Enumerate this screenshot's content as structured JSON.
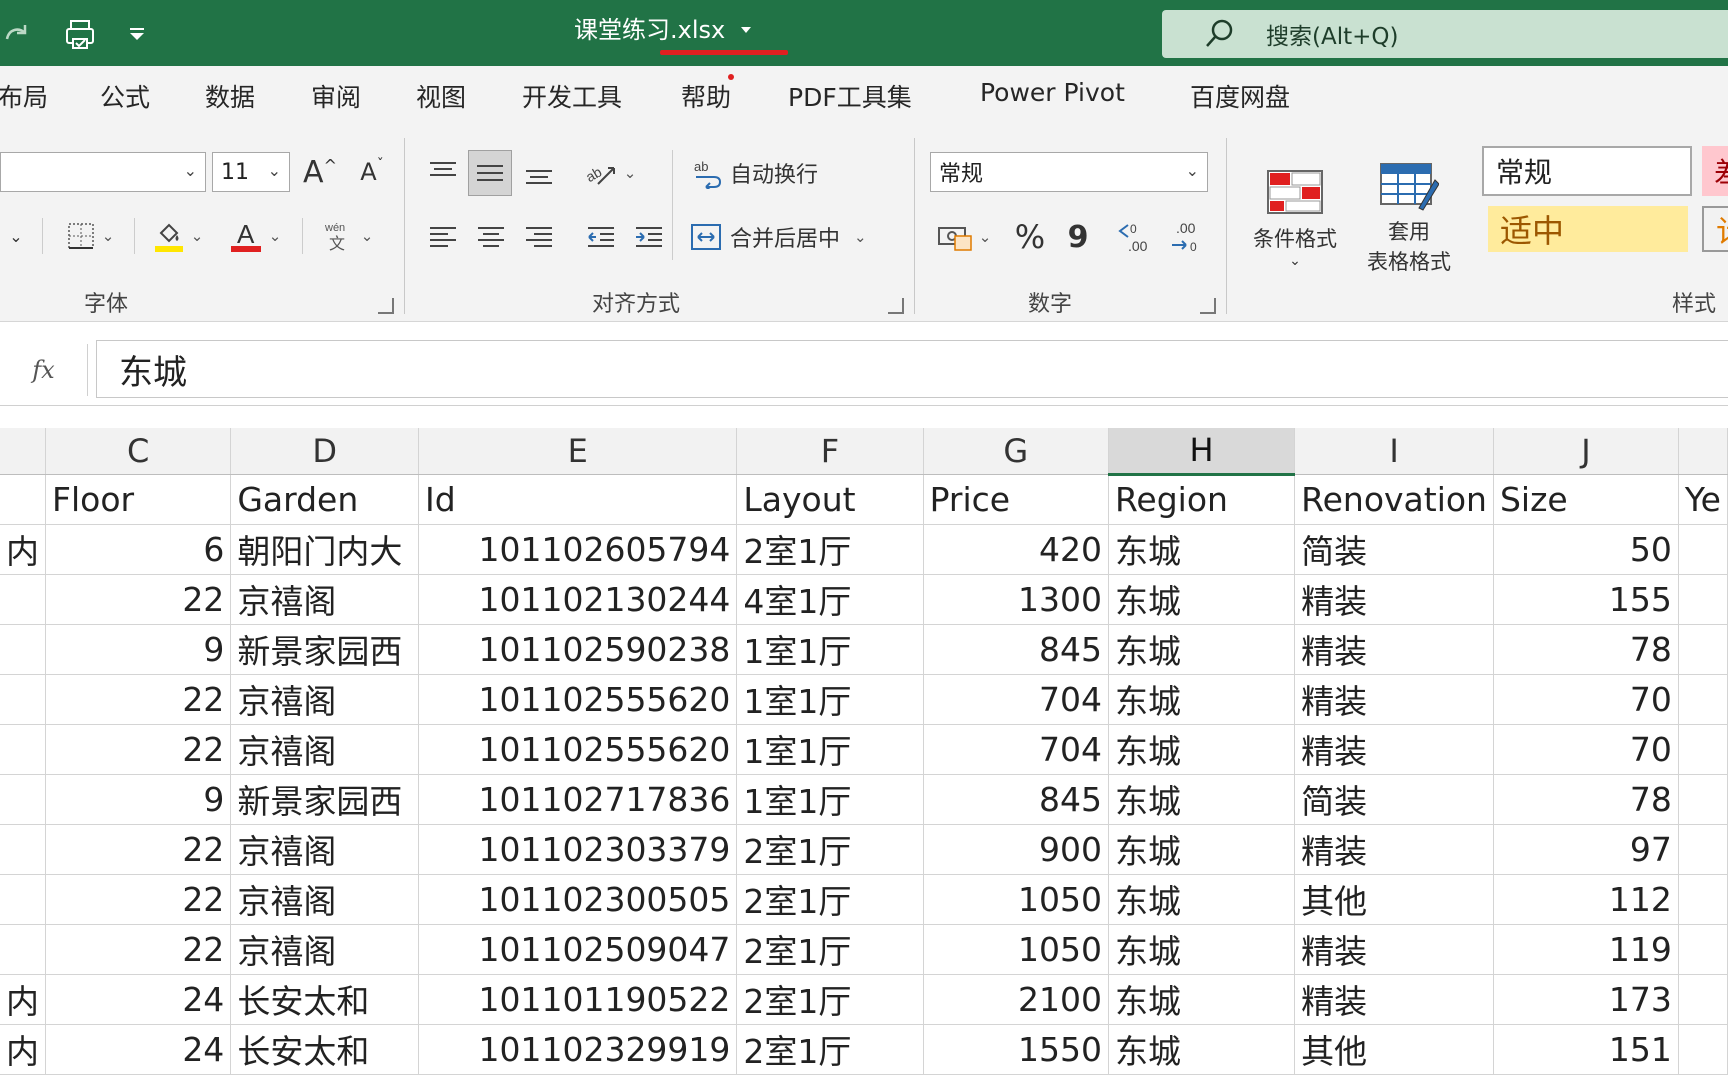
{
  "titlebar": {
    "filename_main": "课堂练习",
    "filename_ext": ".xlsx",
    "search_placeholder": "搜索(Alt+Q)"
  },
  "tabs": [
    "布局",
    "公式",
    "数据",
    "审阅",
    "视图",
    "开发工具",
    "帮助",
    "PDF工具集",
    "Power Pivot",
    "百度网盘"
  ],
  "ribbon": {
    "font": {
      "size": "11",
      "grow_label": "A",
      "shrink_label": "A",
      "group_label": "字体",
      "phonetic_label": "wén"
    },
    "alignment": {
      "wrap_text": "自动换行",
      "merge_center": "合并后居中",
      "group_label": "对齐方式"
    },
    "number": {
      "format": "常规",
      "percent": "%",
      "comma": "9",
      "increase_decimal": ".00",
      "decrease_decimal": ".00",
      "group_label": "数字"
    },
    "styles": {
      "conditional_formatting": "条件格式",
      "format_as_table_line1": "套用",
      "format_as_table_line2": "表格格式",
      "style_normal": "常规",
      "style_neutral": "适中",
      "style_bad_partial": "差",
      "style_calc_partial": "计",
      "group_label": "样式"
    }
  },
  "formula_bar": {
    "fx_label": "fx",
    "value": "东城"
  },
  "grid": {
    "columns": [
      "",
      "C",
      "D",
      "E",
      "F",
      "G",
      "H",
      "I",
      "J",
      ""
    ],
    "selected_column": "H",
    "header": [
      "",
      "Floor",
      "Garden",
      "Id",
      "Layout",
      "Price",
      "Region",
      "Renovation",
      "Size",
      "Ye"
    ],
    "rows": [
      [
        "内",
        "6",
        "朝阳门内大",
        "101102605794",
        "2室1厅",
        "420",
        "东城",
        "简装",
        "50",
        ""
      ],
      [
        "",
        "22",
        "京禧阁",
        "101102130244",
        "4室1厅",
        "1300",
        "东城",
        "精装",
        "155",
        ""
      ],
      [
        "",
        "9",
        "新景家园西",
        "101102590238",
        "1室1厅",
        "845",
        "东城",
        "精装",
        "78",
        ""
      ],
      [
        "",
        "22",
        "京禧阁",
        "101102555620",
        "1室1厅",
        "704",
        "东城",
        "精装",
        "70",
        ""
      ],
      [
        "",
        "22",
        "京禧阁",
        "101102555620",
        "1室1厅",
        "704",
        "东城",
        "精装",
        "70",
        ""
      ],
      [
        "",
        "9",
        "新景家园西",
        "101102717836",
        "1室1厅",
        "845",
        "东城",
        "简装",
        "78",
        ""
      ],
      [
        "",
        "22",
        "京禧阁",
        "101102303379",
        "2室1厅",
        "900",
        "东城",
        "精装",
        "97",
        ""
      ],
      [
        "",
        "22",
        "京禧阁",
        "101102300505",
        "2室1厅",
        "1050",
        "东城",
        "其他",
        "112",
        ""
      ],
      [
        "",
        "22",
        "京禧阁",
        "101102509047",
        "2室1厅",
        "1050",
        "东城",
        "精装",
        "119",
        ""
      ],
      [
        "内",
        "24",
        "长安太和",
        "101101190522",
        "2室1厅",
        "2100",
        "东城",
        "精装",
        "173",
        ""
      ],
      [
        "内",
        "24",
        "长安太和",
        "101102329919",
        "2室1厅",
        "1550",
        "东城",
        "其他",
        "151",
        ""
      ]
    ]
  },
  "colors": {
    "excel_green": "#217346",
    "annotation_red": "#e02020",
    "fill_yellow": "#ffe600",
    "font_red": "#e02020",
    "style_neutral_bg": "#ffeb9c",
    "style_neutral_text": "#9c5700",
    "style_bad_bg": "#ffc7ce",
    "style_bad_text": "#9c0006"
  }
}
